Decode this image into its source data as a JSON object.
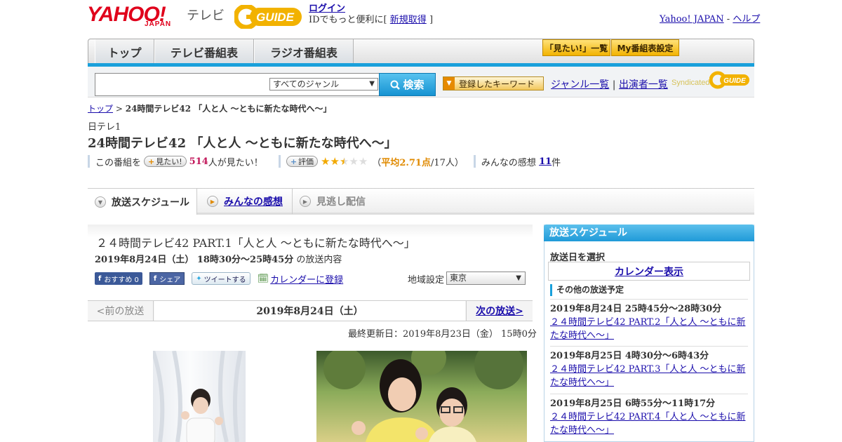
{
  "header": {
    "logo_yahoo": "YAHOO!",
    "logo_japan": "JAPAN",
    "logo_tv": "テレビ",
    "logo_guide": "GUIDE",
    "login": "ログイン",
    "login_sub_prefix": "IDでもっと便利に[",
    "signup": "新規取得",
    "login_sub_suffix": "]",
    "yahoo_japan_link": "Yahoo! JAPAN",
    "sep": "-",
    "help": "ヘルプ"
  },
  "nav": {
    "tabs": [
      "トップ",
      "テレビ番組表",
      "ラジオ番組表"
    ],
    "want_list": "「見たい!」一覧",
    "my_schedule": "My番組表設定"
  },
  "search": {
    "genre": "すべてのジャンル",
    "button": "検索",
    "keyword_button": "登録したキーワード",
    "genre_list": "ジャンル一覧",
    "divider": "|",
    "performer_list": "出演者一覧",
    "syndicated": "Syndicated"
  },
  "breadcrumb": {
    "top": "トップ",
    "sep": ">",
    "current": "24時間テレビ42 「人と人 ～ともに新たな時代へ～」"
  },
  "program": {
    "channel": "日テレ1",
    "title": "24時間テレビ42 「人と人 ～ともに新たな時代へ～」",
    "want_prefix": "この番組を",
    "want_button": "見たい!",
    "want_count": "514",
    "want_suffix": "人が見たい！",
    "rate_button": "評価",
    "rating_open": "（",
    "rating_avg": "平均2.71点",
    "rating_count": "/17人）",
    "reviews_label": "みんなの感想",
    "reviews_count": "11",
    "reviews_unit": "件",
    "rating_value": 2.71
  },
  "tabs": [
    "放送スケジュール",
    "みんなの感想",
    "見逃し配信"
  ],
  "episode": {
    "title": "２４時間テレビ42 PART.1「人と人 ～ともに新たな時代へ～」",
    "datetime": "2019年8月24日（土） 18時30分～25時45分",
    "datetime_suffix": "の放送内容",
    "recommend": "おすすめ 0",
    "share": "シェア",
    "tweet": "ツイートする",
    "calendar": "カレンダーに登録",
    "region_label": "地域設定",
    "region": "東京"
  },
  "daynav": {
    "prev": "<前の放送",
    "current": "2019年8月24日（土）",
    "next": "次の放送>"
  },
  "updated": "最終更新日：2019年8月23日（金） 15時0分",
  "sidebar": {
    "title": "放送スケジュール",
    "select_date": "放送日を選択",
    "calendar": "カレンダー表示",
    "other_label": "その他の放送予定",
    "items": [
      {
        "time": "2019年8月24日 25時45分～28時30分",
        "title": "２４時間テレビ42 PART.2「人と人 ～ともに新たな時代へ～」"
      },
      {
        "time": "2019年8月25日 4時30分～6時43分",
        "title": "２４時間テレビ42 PART.3「人と人 ～ともに新たな時代へ～」"
      },
      {
        "time": "2019年8月25日 6時55分～11時17分",
        "title": "２４時間テレビ42 PART.4「人と人 ～ともに新たな時代へ～」"
      }
    ]
  },
  "colors": {
    "accent": "#19a0db",
    "brand_red": "#e0001b",
    "gold": "#f2b200"
  }
}
